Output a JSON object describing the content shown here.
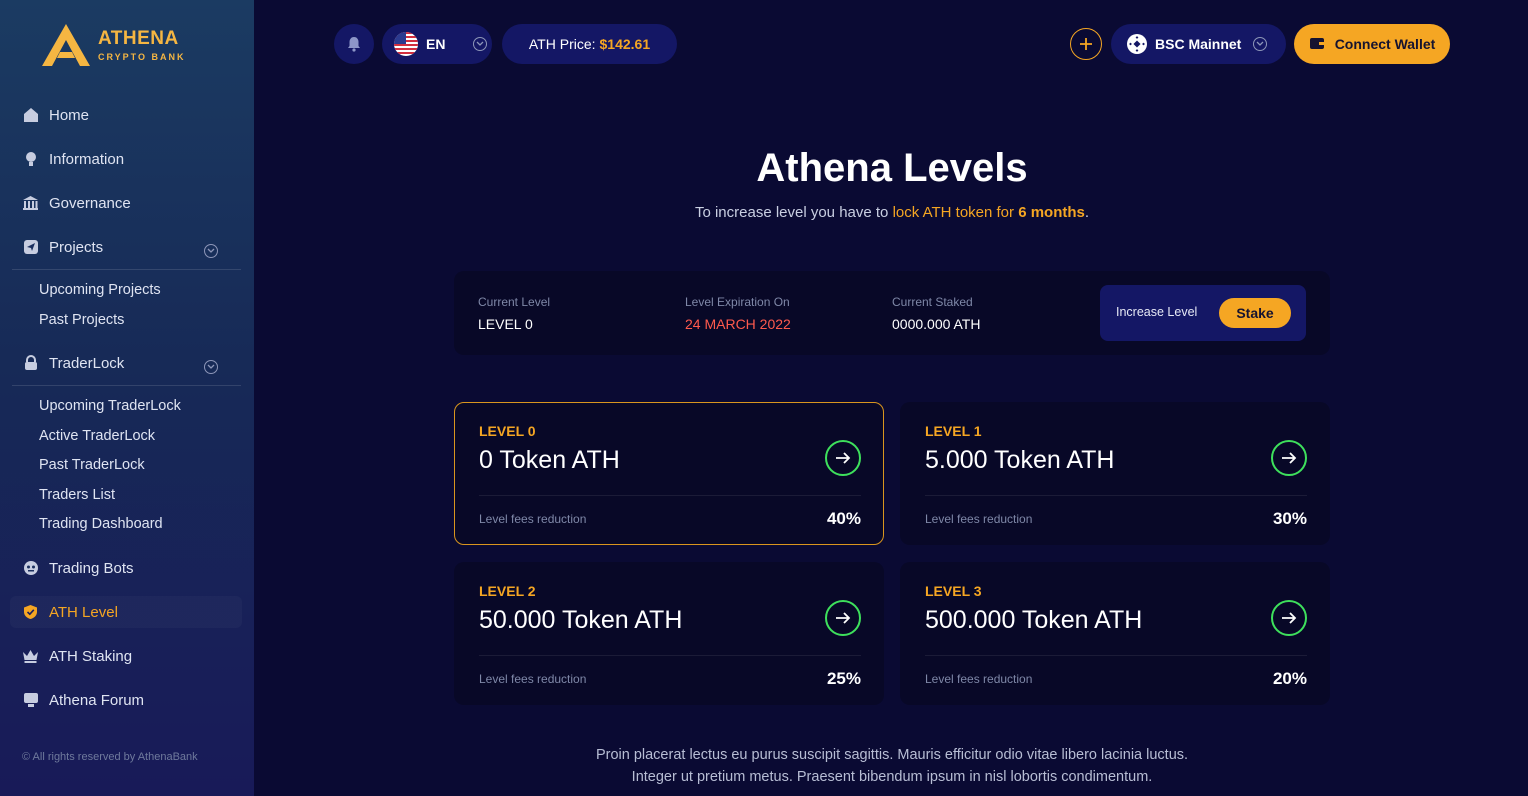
{
  "brand": {
    "name": "ATHENA",
    "tagline": "CRYPTO BANK"
  },
  "sidebar": {
    "items": {
      "home": "Home",
      "information": "Information",
      "governance": "Governance",
      "projects": "Projects",
      "traderlock": "TraderLock",
      "trading_bots": "Trading Bots",
      "ath_level": "ATH Level",
      "ath_staking": "ATH Staking",
      "athena_forum": "Athena Forum"
    },
    "projects_sub": [
      "Upcoming Projects",
      "Past Projects"
    ],
    "traderlock_sub": [
      "Upcoming TraderLock",
      "Active TraderLock",
      "Past TraderLock",
      "Traders List",
      "Trading Dashboard"
    ],
    "footer": "© All rights reserved by AthenaBank"
  },
  "topbar": {
    "language": "EN",
    "price_label": "ATH Price:",
    "price_value": "$142.61",
    "network": "BSC Mainnet",
    "connect": "Connect Wallet"
  },
  "page": {
    "title": "Athena Levels",
    "subtitle_pre": "To increase level you have to ",
    "subtitle_link": "lock ATH token for ",
    "subtitle_bold": "6 months",
    "subtitle_post": "."
  },
  "status": {
    "current_level_label": "Current Level",
    "current_level": "LEVEL 0",
    "expiration_label": "Level Expiration On",
    "expiration": "24 MARCH 2022",
    "staked_label": "Current Staked",
    "staked": "0000.000 ATH",
    "increase_label": "Increase Level",
    "stake_button": "Stake"
  },
  "levels": [
    {
      "level": "LEVEL 0",
      "tokens": "0 Token ATH",
      "fees_label": "Level fees reduction",
      "fees": "40%"
    },
    {
      "level": "LEVEL 1",
      "tokens": "5.000 Token ATH",
      "fees_label": "Level fees reduction",
      "fees": "30%"
    },
    {
      "level": "LEVEL 2",
      "tokens": "50.000 Token ATH",
      "fees_label": "Level fees reduction",
      "fees": "25%"
    },
    {
      "level": "LEVEL 3",
      "tokens": "500.000 Token ATH",
      "fees_label": "Level fees reduction",
      "fees": "20%"
    }
  ],
  "description": {
    "line1": "Proin placerat lectus eu purus suscipit sagittis. Mauris efficitur odio vitae libero lacinia luctus.",
    "line2": "Integer ut pretium metus. Praesent bibendum ipsum in nisl lobortis condimentum."
  },
  "colors": {
    "accent": "#f5a623",
    "success": "#3ee05c",
    "danger": "#ff5a4d",
    "background": "#0a0a33"
  }
}
